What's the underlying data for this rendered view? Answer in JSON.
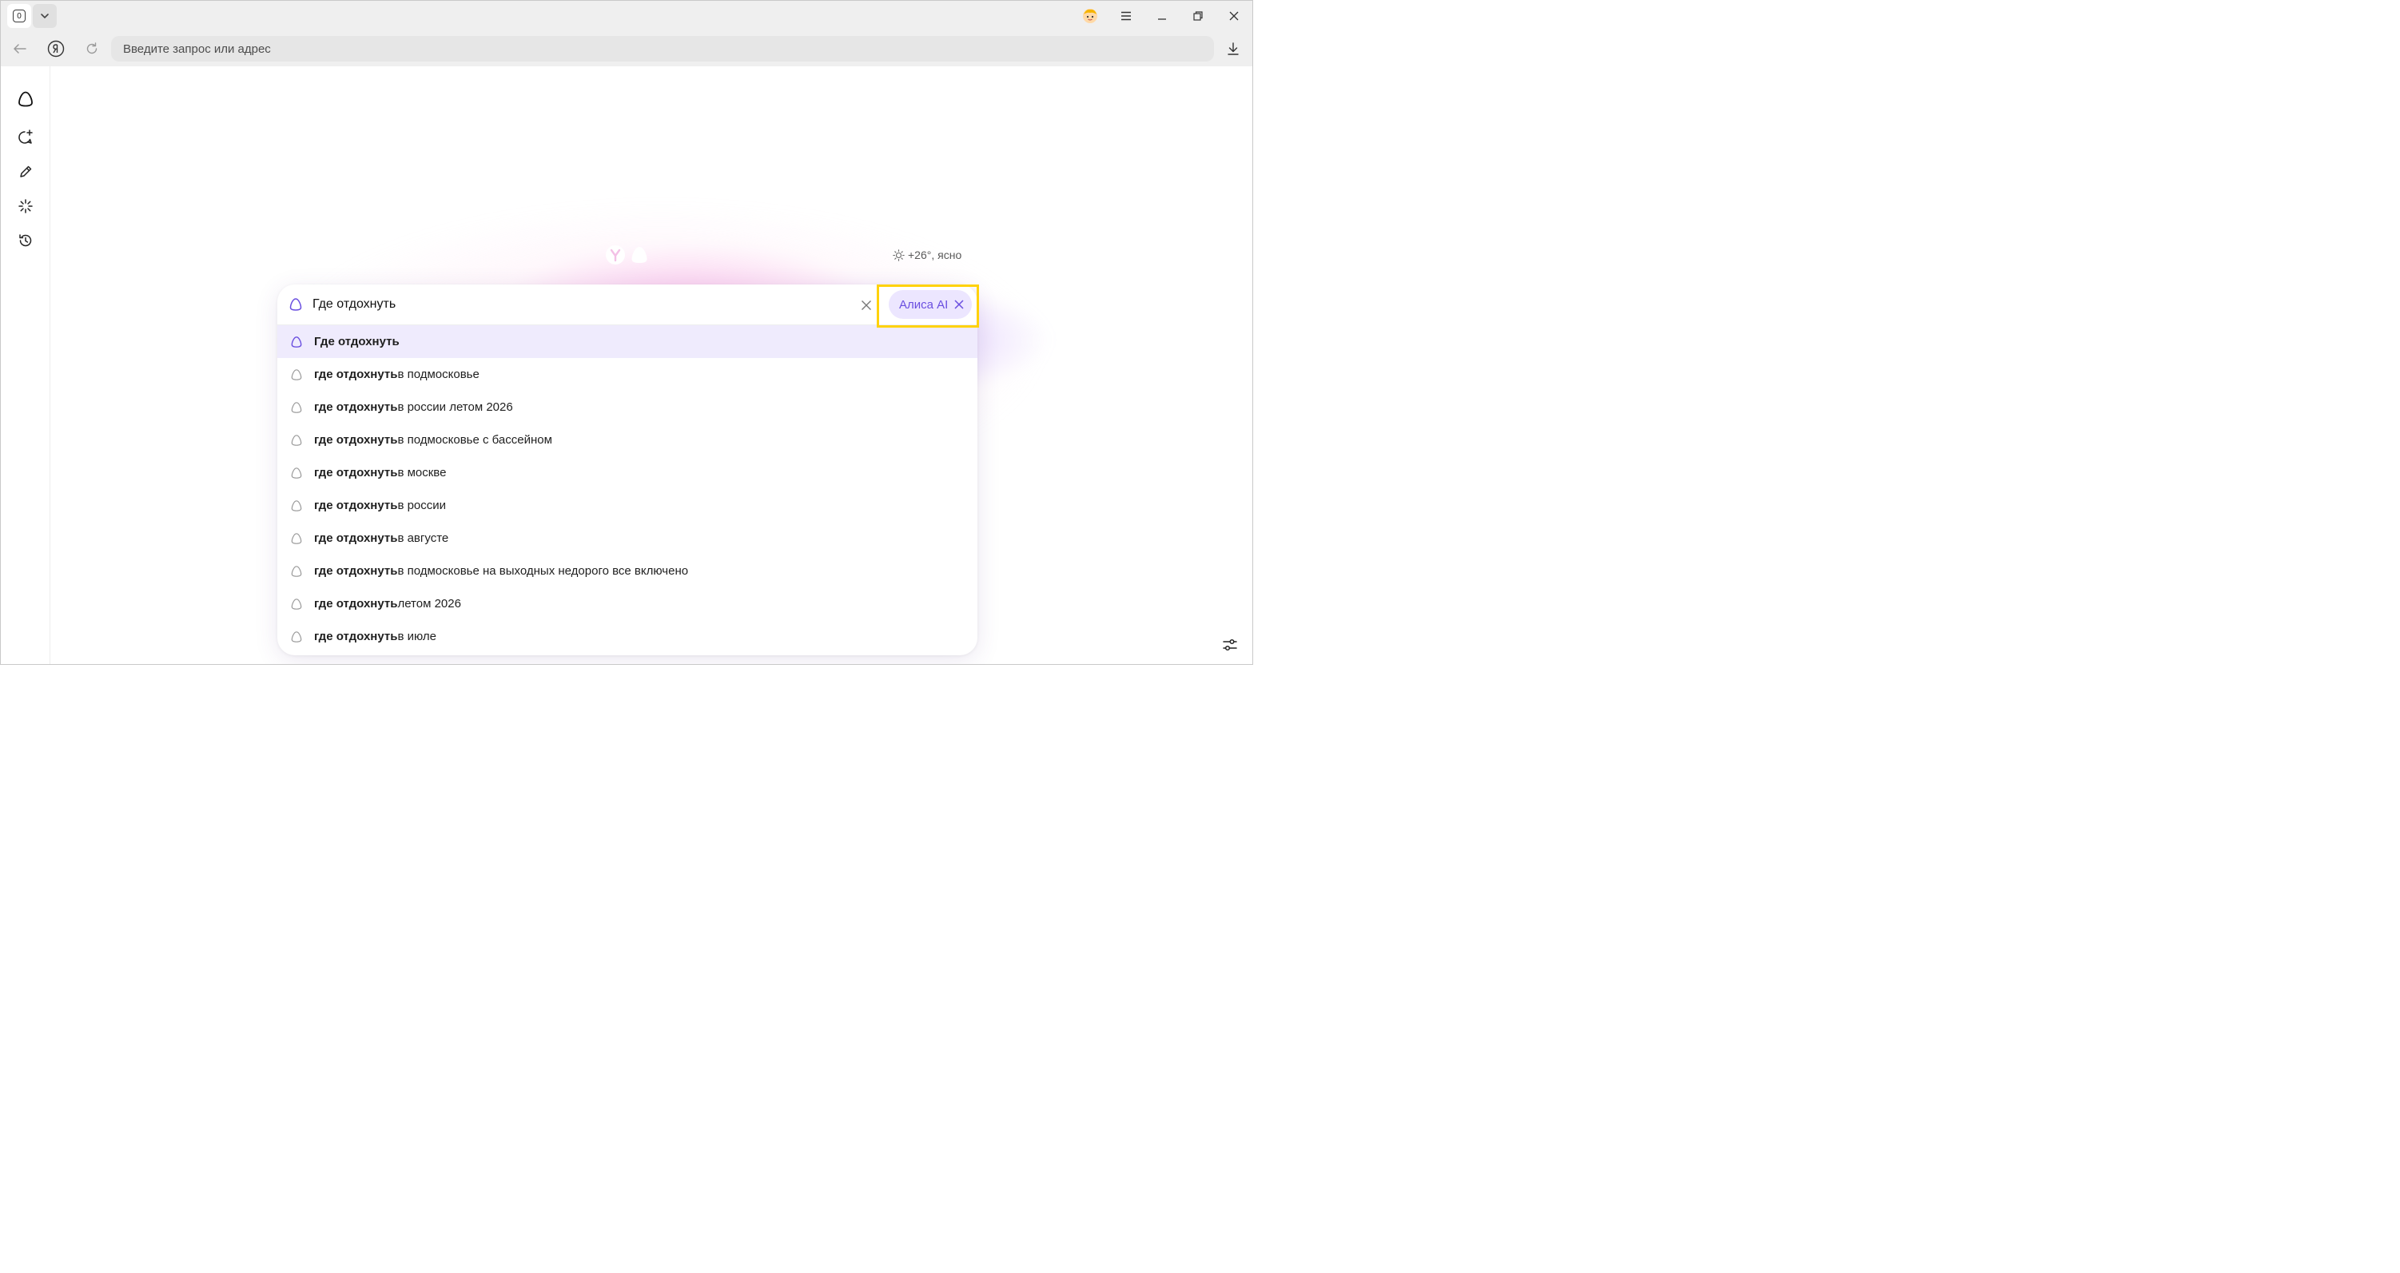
{
  "tab_bar": {
    "tab_count": "0"
  },
  "address_bar": {
    "placeholder": "Введите запрос или адрес",
    "value": ""
  },
  "new_tab": {
    "weather": "+26°, ясно",
    "search": {
      "query": "Где отдохнуть",
      "chip_label": "Алиса AI"
    },
    "suggestions": [
      {
        "bold": "Где отдохнуть",
        "rest": ""
      },
      {
        "bold": "где отдохнуть",
        "rest": " в подмосковье"
      },
      {
        "bold": "где отдохнуть",
        "rest": " в россии летом 2026"
      },
      {
        "bold": "где отдохнуть",
        "rest": " в подмосковье с бассейном"
      },
      {
        "bold": "где отдохнуть",
        "rest": " в москве"
      },
      {
        "bold": "где отдохнуть",
        "rest": " в россии"
      },
      {
        "bold": "где отдохнуть",
        "rest": " в августе"
      },
      {
        "bold": "где отдохнуть",
        "rest": " в подмосковье на выходных недорого все включено"
      },
      {
        "bold": "где отдохнуть",
        "rest": " летом 2026"
      },
      {
        "bold": "где отдохнуть",
        "rest": " в июле"
      }
    ]
  },
  "colors": {
    "accent": "#6a4fe0",
    "chip_bg": "#ece6ff",
    "active_row": "#efebfd",
    "highlight": "#ffd20a"
  }
}
